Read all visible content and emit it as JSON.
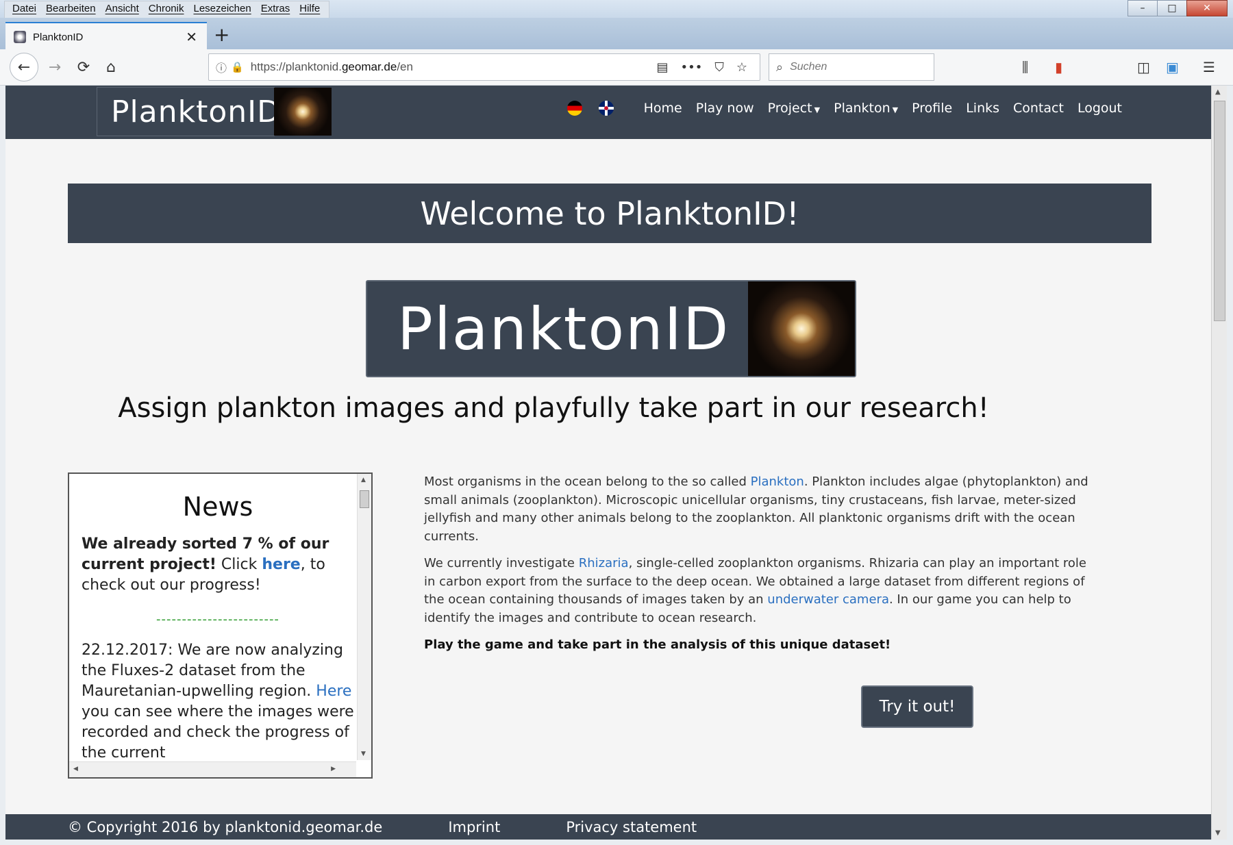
{
  "browser": {
    "menus": [
      "Datei",
      "Bearbeiten",
      "Ansicht",
      "Chronik",
      "Lesezeichen",
      "Extras",
      "Hilfe"
    ],
    "tab_title": "PlanktonID",
    "url_host": "https://planktonid.",
    "url_bold": "geomar.de",
    "url_path": "/en",
    "search_placeholder": "Suchen",
    "window_controls": {
      "minimize": "–",
      "maximize": "□",
      "close": "✕"
    }
  },
  "site": {
    "logo_text": "PlanktonID",
    "nav": {
      "home": "Home",
      "play": "Play now",
      "project": "Project",
      "plankton": "Plankton",
      "profile": "Profile",
      "links": "Links",
      "contact": "Contact",
      "logout": "Logout"
    },
    "banner_title": "Welcome to PlanktonID!",
    "tagline": "Assign plankton images and playfully take part in our research!",
    "news": {
      "heading": "News",
      "highlight_pre": "We already sorted 7 % of our current project!",
      "highlight_click": " Click ",
      "highlight_link": "here",
      "highlight_post": ", to check out our progress!",
      "divider": "------------------------",
      "item_date_text": "22.12.2017: We are now analyzing the Fluxes-2 dataset from the Mauretanian-upwelling region. ",
      "item_link": "Here",
      "item_rest": " you can see where the images were recorded and check the progress of the current"
    },
    "content": {
      "p1_a": "Most organisms in the ocean belong to the so called ",
      "p1_link": "Plankton",
      "p1_b": ". Plankton includes algae (phytoplankton) and small animals (zooplankton). Microscopic unicellular organisms, tiny crustaceans, fish larvae, meter-sized jellyfish and many other animals belong to the zooplankton. All planktonic organisms drift with the ocean currents.",
      "p2_a": "We currently investigate ",
      "p2_link1": "Rhizaria",
      "p2_b": ", single-celled zooplankton organisms. Rhizaria can play an important role in carbon export from the surface to the deep ocean. We obtained a large dataset from different regions of the ocean containing thousands of images taken by an ",
      "p2_link2": "underwater camera",
      "p2_c": ". In our game you can help to identify the images and contribute to ocean research.",
      "cta": "Play the game and take part in the analysis of this unique dataset!"
    },
    "try_button": "Try it out!",
    "footer": {
      "copyright": "© Copyright 2016 by planktonid.geomar.de",
      "imprint": "Imprint",
      "privacy": "Privacy statement"
    }
  }
}
